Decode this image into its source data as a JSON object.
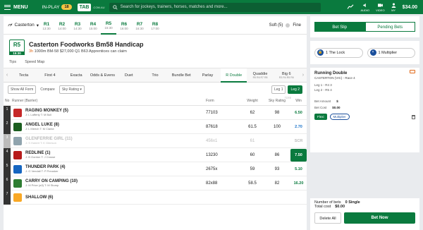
{
  "topbar": {
    "menu_label": "MENU",
    "inplay_label": "IN-PLAY",
    "inplay_count": "18",
    "logo": "TAB",
    "logo_sub": ".COM.AU",
    "search_placeholder": "Search for jockeys, trainers, horses, matches and more...",
    "icons": [
      {
        "name": "racing-icon",
        "label": ""
      },
      {
        "name": "audio-icon",
        "label": "AUDIO"
      },
      {
        "name": "video-icon",
        "label": "VIDEO"
      },
      {
        "name": "account-icon",
        "label": "MY"
      }
    ],
    "balance": "$34.00"
  },
  "race_nav": {
    "venue": "Casterton",
    "races": [
      {
        "num": "R1",
        "time": "13:30",
        "active": false
      },
      {
        "num": "R2",
        "time": "14:00",
        "active": false
      },
      {
        "num": "R3",
        "time": "14:30",
        "active": false
      },
      {
        "num": "R4",
        "time": "15:00",
        "active": false
      },
      {
        "num": "R5",
        "time": "15:30",
        "active": true
      },
      {
        "num": "R6",
        "time": "16:00",
        "active": false
      },
      {
        "num": "R7",
        "time": "16:30",
        "active": false
      },
      {
        "num": "R8",
        "time": "17:00",
        "active": false
      }
    ],
    "track": "Soft (5)",
    "weather": "Fine"
  },
  "race": {
    "badge": "R5",
    "badge_time": "15:30",
    "title": "Casterton Foodworks Bm58 Handicap",
    "countdown": "3h",
    "details": "1000m   BM-58   $27,000   Q1   B63   Apprentices can claim"
  },
  "links": [
    "Tips",
    "Speed Map"
  ],
  "bet_tabs": [
    {
      "label": "Tecta",
      "sub": ""
    },
    {
      "label": "First 4",
      "sub": ""
    },
    {
      "label": "Exacta",
      "sub": ""
    },
    {
      "label": "Odds & Evens",
      "sub": ""
    },
    {
      "label": "Duet",
      "sub": ""
    },
    {
      "label": "Trio",
      "sub": ""
    },
    {
      "label": "Bundle Bet",
      "sub": ""
    },
    {
      "label": "Parlay",
      "sub": ""
    },
    {
      "label": "R Double",
      "sub": "",
      "active": true
    },
    {
      "label": "Quaddie",
      "sub": "R5 R6 R7 R8"
    },
    {
      "label": "Big 6",
      "sub": "R3 R4 R5 R6"
    }
  ],
  "controls": {
    "show_all_form": "Show All Form",
    "compare_label": "Compare",
    "compare_value": "Sky Rating",
    "leg1": "Leg 1",
    "leg2": "Leg 2"
  },
  "columns": {
    "no": "No",
    "runner": "Runner (Barrier)",
    "form": "Form",
    "weight": "Weight",
    "rating": "Sky Rating",
    "win": "Win",
    "tote": "TOTE"
  },
  "runners": [
    {
      "num": "1",
      "name": "RAGING MONKEY (5)",
      "jt": "J: L Lafferty  T: M Bull",
      "form": "77103",
      "weight": "62",
      "rating": "98",
      "win": "6.50",
      "color": "#c62828",
      "scratched": false,
      "win_style": ""
    },
    {
      "num": "2",
      "name": "ANGEL LUKE (8)",
      "jt": "J: L Meech  T: M Clarke",
      "form": "87618",
      "weight": "61.5",
      "rating": "100",
      "win": "2.70",
      "color": "#1b5e20",
      "scratched": false,
      "win_style": "blue"
    },
    {
      "num": "3",
      "name": "GLENFERRIE GIRL (11)",
      "jt": "J: S Hubert  T: K Gleeson",
      "form": "456x1",
      "weight": "61",
      "rating": "",
      "win": "SCR",
      "color": "#90a4ae",
      "scratched": true,
      "win_style": ""
    },
    {
      "num": "4",
      "name": "REDLINE (1)",
      "jt": "J: B Gordon  T: J Crosse",
      "form": "13230",
      "weight": "60",
      "rating": "86",
      "win": "7.50",
      "color": "#b71c1c",
      "scratched": false,
      "win_style": "sel"
    },
    {
      "num": "5",
      "name": "THUNDER PARK (4)",
      "jt": "J: G Vendall  T: P Preusker",
      "form": "2675x",
      "weight": "59",
      "rating": "93",
      "win": "5.10",
      "color": "#1565c0",
      "scratched": false,
      "win_style": ""
    },
    {
      "num": "6",
      "name": "CARRY ON CAMPING (10)",
      "jt": "J: M Price (a3)  T: M Stump",
      "form": "82x88",
      "weight": "58.5",
      "rating": "82",
      "win": "16.20",
      "color": "#2e7d32",
      "scratched": false,
      "win_style": ""
    },
    {
      "num": "7",
      "name": "SHALLOW (6)",
      "jt": "",
      "form": "",
      "weight": "",
      "rating": "",
      "win": "",
      "color": "#f9a825",
      "scratched": false,
      "win_style": ""
    }
  ],
  "betslip": {
    "tab_slip": "Bet Slip",
    "tab_pending": "Pending Bets",
    "promo_lock": "1 The Lock",
    "promo_multi": "1 Multiplier",
    "card_title": "Running Double",
    "card_sub": "CASTERTON (VIC) - Race 4",
    "leg1": "Leg 1 - R4   3",
    "leg2": "Leg 2 - R5   4",
    "bet_amount_label": "Bet Amount",
    "bet_amount": "$",
    "bet_cost_label": "Bet Cost",
    "bet_cost": "$0.00",
    "flexi": "Flexi",
    "multiplier": "Multiplier",
    "num_bets_label": "Number of bets",
    "num_bets": "0 Single",
    "total_cost_label": "Total cost",
    "total_cost": "$0.00",
    "delete_all": "Delete All",
    "bet_now": "Bet Now"
  }
}
